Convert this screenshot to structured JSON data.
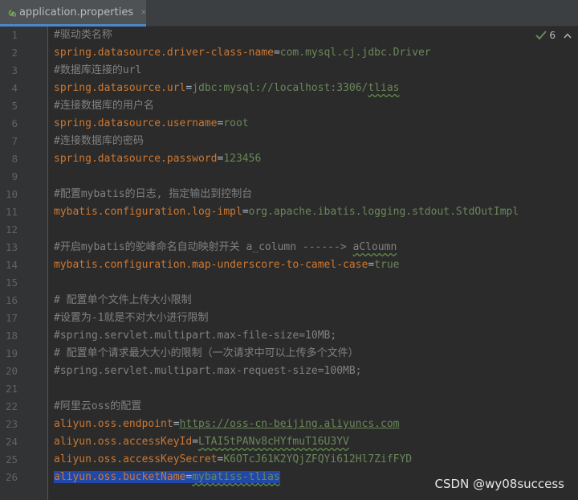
{
  "tab": {
    "filename": "application.properties",
    "icon": "spring-leaf-icon"
  },
  "inspection": {
    "count": "6",
    "icon": "check-icon"
  },
  "lines": [
    {
      "n": "1",
      "parts": [
        {
          "t": "#驱动类名称",
          "s": "c"
        }
      ]
    },
    {
      "n": "2",
      "parts": [
        {
          "t": "spring.datasource.driver-class-name",
          "s": "k"
        },
        {
          "t": "=",
          "s": "e"
        },
        {
          "t": "com.mysql.cj.jdbc.Driver",
          "s": "v"
        }
      ]
    },
    {
      "n": "3",
      "parts": [
        {
          "t": "#数据库连接的url",
          "s": "c"
        }
      ]
    },
    {
      "n": "4",
      "parts": [
        {
          "t": "spring.datasource.url",
          "s": "k"
        },
        {
          "t": "=",
          "s": "e"
        },
        {
          "t": "jdbc:mysql://localhost:3306/",
          "s": "v"
        },
        {
          "t": "tlias",
          "s": "v squig"
        }
      ]
    },
    {
      "n": "5",
      "parts": [
        {
          "t": "#连接数据库的用户名",
          "s": "c"
        }
      ]
    },
    {
      "n": "6",
      "parts": [
        {
          "t": "spring.datasource.username",
          "s": "k"
        },
        {
          "t": "=",
          "s": "e"
        },
        {
          "t": "root",
          "s": "v"
        }
      ]
    },
    {
      "n": "7",
      "parts": [
        {
          "t": "#连接数据库的密码",
          "s": "c"
        }
      ]
    },
    {
      "n": "8",
      "parts": [
        {
          "t": "spring.datasource.password",
          "s": "k"
        },
        {
          "t": "=",
          "s": "e"
        },
        {
          "t": "123456",
          "s": "v"
        }
      ]
    },
    {
      "n": "9",
      "parts": []
    },
    {
      "n": "10",
      "parts": [
        {
          "t": "#配置mybatis的日志, 指定输出到控制台",
          "s": "c"
        }
      ]
    },
    {
      "n": "11",
      "parts": [
        {
          "t": "mybatis.configuration.log-impl",
          "s": "k"
        },
        {
          "t": "=",
          "s": "e"
        },
        {
          "t": "org.apache.ibatis.logging.stdout.StdOutImpl",
          "s": "v"
        }
      ]
    },
    {
      "n": "12",
      "parts": []
    },
    {
      "n": "13",
      "parts": [
        {
          "t": "#开启mybatis的驼峰命名自动映射开关 a_column ------> ",
          "s": "c"
        },
        {
          "t": "aCloumn",
          "s": "c squig"
        }
      ]
    },
    {
      "n": "14",
      "parts": [
        {
          "t": "mybatis.configuration.map-underscore-to-camel-case",
          "s": "k"
        },
        {
          "t": "=",
          "s": "e"
        },
        {
          "t": "true",
          "s": "v"
        }
      ]
    },
    {
      "n": "15",
      "parts": []
    },
    {
      "n": "16",
      "parts": [
        {
          "t": "# 配置单个文件上传大小限制",
          "s": "c"
        }
      ]
    },
    {
      "n": "17",
      "parts": [
        {
          "t": "#设置为-1就是不对大小进行限制",
          "s": "c"
        }
      ]
    },
    {
      "n": "18",
      "parts": [
        {
          "t": "#spring.servlet.multipart.max-file-size=10MB;",
          "s": "c"
        }
      ]
    },
    {
      "n": "19",
      "parts": [
        {
          "t": "# 配置单个请求最大大小的限制（一次请求中可以上传多个文件）",
          "s": "c"
        }
      ]
    },
    {
      "n": "20",
      "parts": [
        {
          "t": "#spring.servlet.multipart.max-request-size=100MB;",
          "s": "c"
        }
      ]
    },
    {
      "n": "21",
      "parts": []
    },
    {
      "n": "22",
      "parts": [
        {
          "t": "#阿里云oss的配置",
          "s": "c"
        }
      ]
    },
    {
      "n": "23",
      "parts": [
        {
          "t": "aliyun.oss.endpoint",
          "s": "k"
        },
        {
          "t": "=",
          "s": "e"
        },
        {
          "t": "https://oss-cn-beijing.aliyuncs.com",
          "s": "link"
        }
      ]
    },
    {
      "n": "24",
      "parts": [
        {
          "t": "aliyun.oss.accessKeyId",
          "s": "k"
        },
        {
          "t": "=",
          "s": "e"
        },
        {
          "t": "LTAI5tPANv8cHYfmuT16U3YV",
          "s": "v squig"
        }
      ]
    },
    {
      "n": "25",
      "parts": [
        {
          "t": "aliyun.oss.accessKeySecret",
          "s": "k"
        },
        {
          "t": "=",
          "s": "e"
        },
        {
          "t": "K6OTcJ61K2YQjZFQYi612Hl7ZifFYD",
          "s": "v"
        }
      ]
    },
    {
      "n": "26",
      "parts": [
        {
          "t": "aliyun.oss.bucketName",
          "s": "k"
        },
        {
          "t": "=",
          "s": "e"
        },
        {
          "t": "mybatiss-tlias",
          "s": "v squig"
        }
      ],
      "selected": true
    }
  ],
  "watermark": "CSDN @wy08success"
}
